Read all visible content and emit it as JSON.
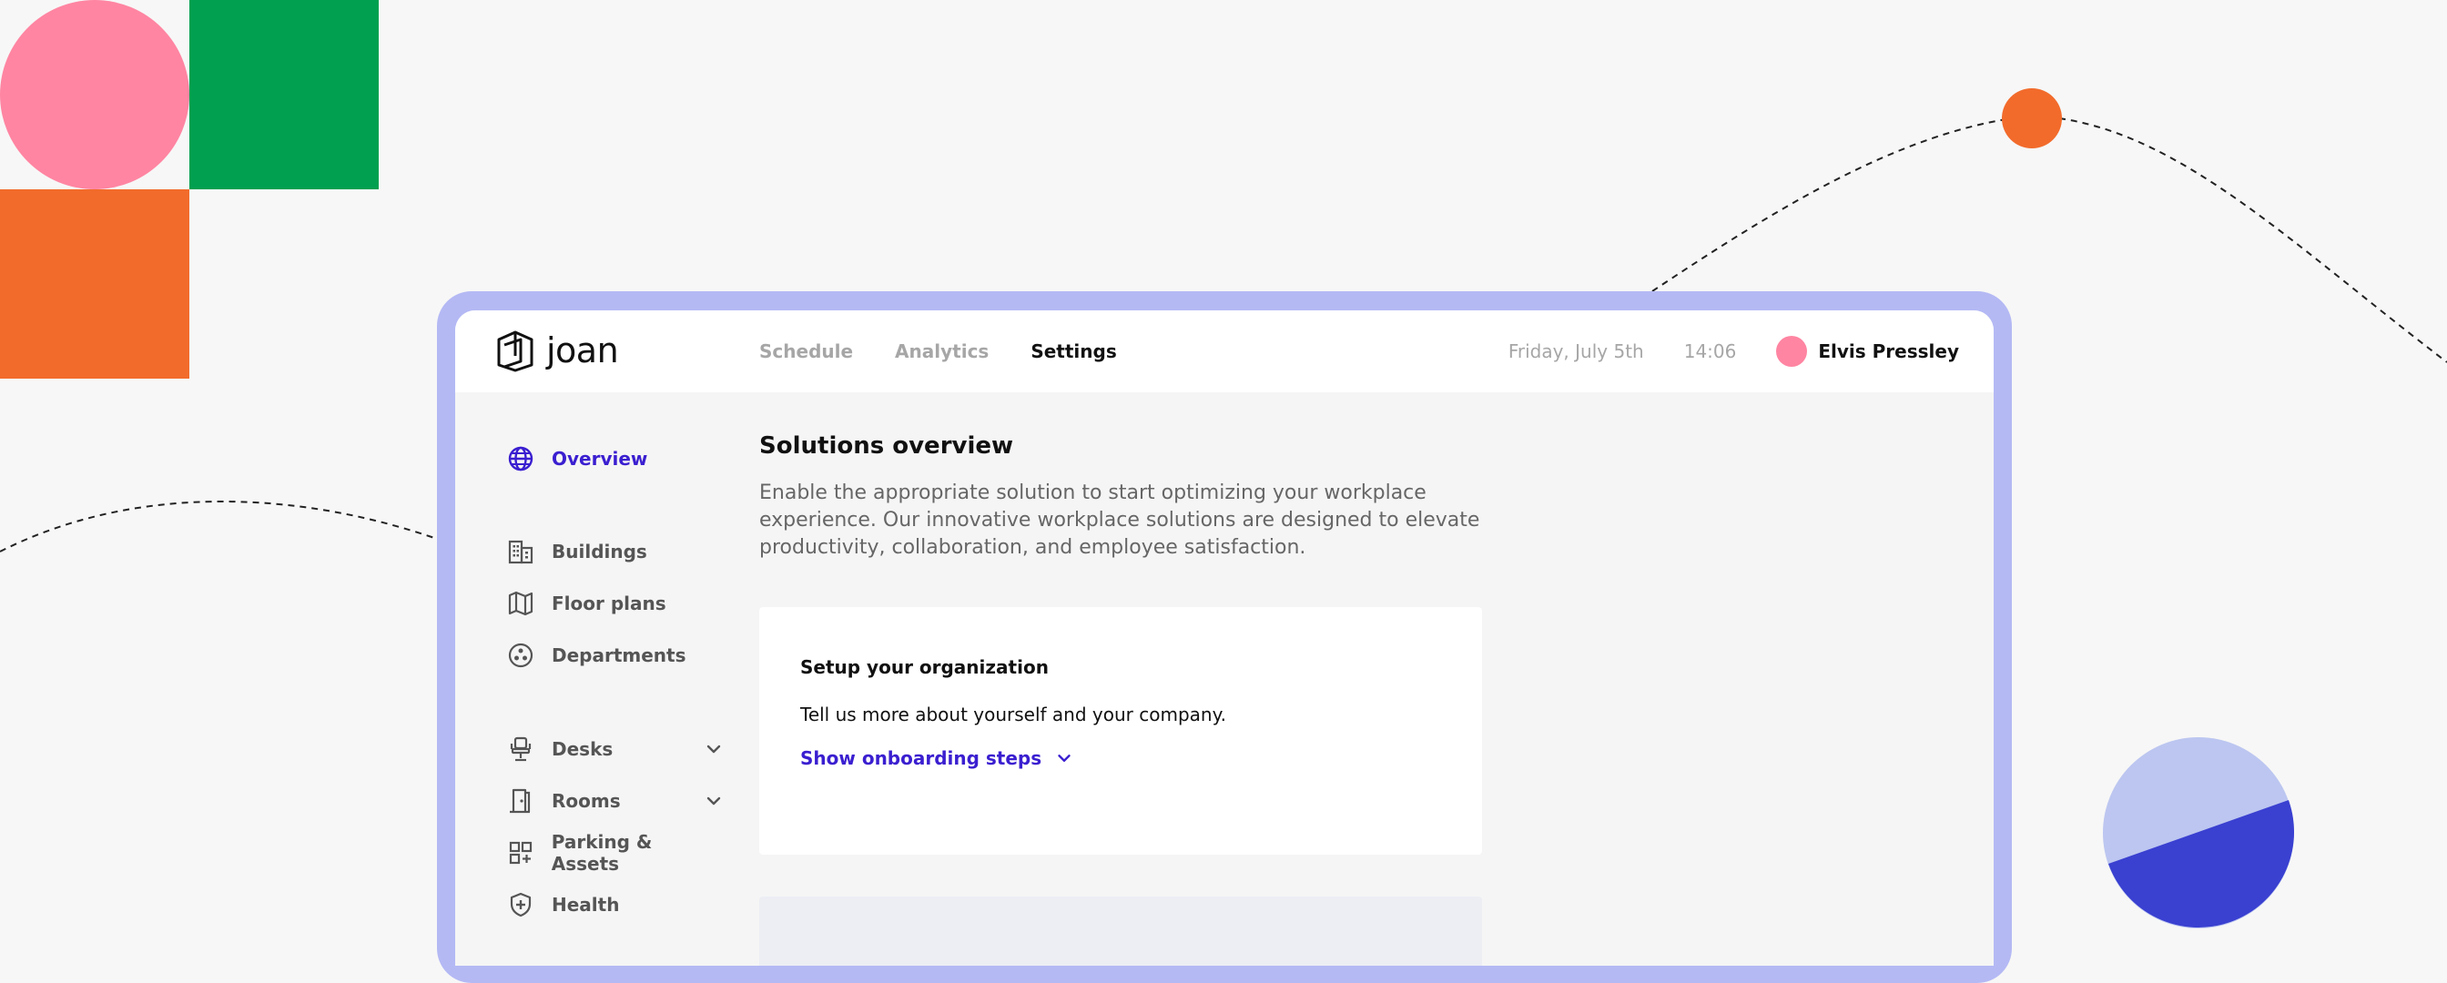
{
  "header": {
    "logo_text": "joan",
    "nav": [
      "Schedule",
      "Analytics",
      "Settings"
    ],
    "active_nav": "Settings",
    "date": "Friday, July 5th",
    "time": "14:06",
    "user_name": "Elvis Pressley"
  },
  "sidebar": {
    "items": [
      {
        "label": "Overview",
        "icon": "globe-icon",
        "active": true
      },
      {
        "label": "Buildings",
        "icon": "building-icon"
      },
      {
        "label": "Floor plans",
        "icon": "map-icon"
      },
      {
        "label": "Departments",
        "icon": "departments-icon"
      },
      {
        "label": "Desks",
        "icon": "chair-icon",
        "expandable": true
      },
      {
        "label": "Rooms",
        "icon": "door-icon",
        "expandable": true
      },
      {
        "label": "Parking & Assets",
        "icon": "grid-plus-icon"
      },
      {
        "label": "Health",
        "icon": "shield-icon"
      }
    ]
  },
  "main": {
    "title": "Solutions overview",
    "description": "Enable the appropriate solution to start optimizing your workplace experience. Our innovative workplace solutions are designed to elevate productivity, collaboration, and employee satisfaction.",
    "card": {
      "title": "Setup your organization",
      "text": "Tell us more about yourself and your company.",
      "link": "Show onboarding steps"
    }
  },
  "colors": {
    "accent": "#3a1fd0",
    "frame": "#b4b9f4",
    "pink": "#ff85a2",
    "green": "#00a050",
    "orange": "#f26b2b",
    "pie_light": "#bcc6f0",
    "pie_dark": "#3a40d0"
  }
}
